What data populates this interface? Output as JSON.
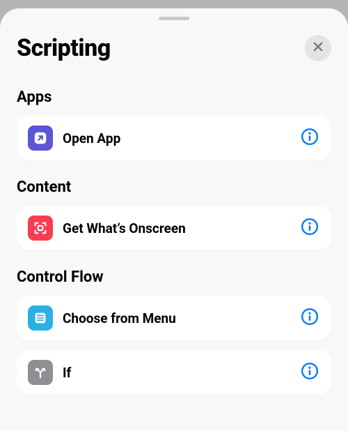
{
  "header": {
    "title": "Scripting"
  },
  "sections": [
    {
      "title": "Apps",
      "items": [
        {
          "label": "Open App",
          "icon": "open-app-icon",
          "color": "purple"
        }
      ]
    },
    {
      "title": "Content",
      "items": [
        {
          "label": "Get What’s Onscreen",
          "icon": "onscreen-icon",
          "color": "red"
        }
      ]
    },
    {
      "title": "Control Flow",
      "items": [
        {
          "label": "Choose from Menu",
          "icon": "menu-icon",
          "color": "cyan"
        },
        {
          "label": "If",
          "icon": "branch-icon",
          "color": "gray"
        }
      ]
    }
  ],
  "colors": {
    "info": "#007aff"
  }
}
